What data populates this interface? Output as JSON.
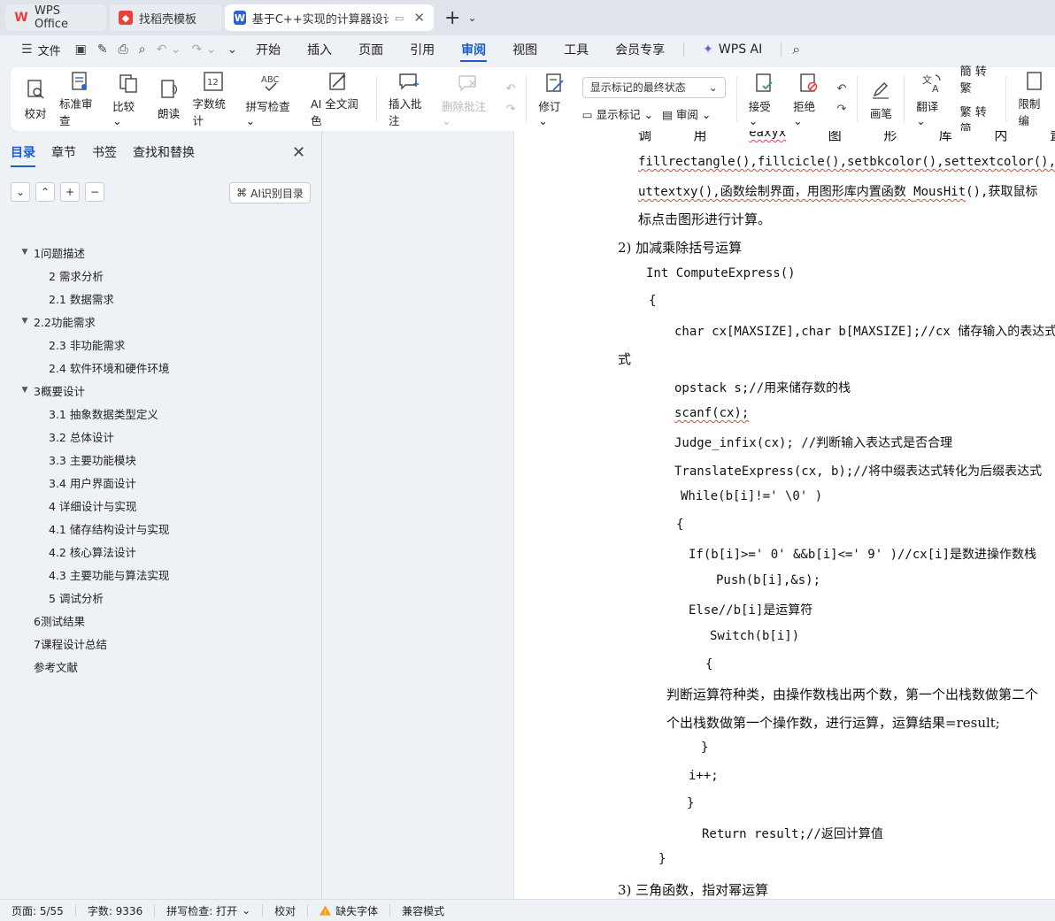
{
  "tabs": [
    {
      "label": "WPS Office",
      "active": false
    },
    {
      "label": "找稻壳模板",
      "active": false
    },
    {
      "label": "基于C++实现的计算器设计 说",
      "active": true
    }
  ],
  "menubar": {
    "file_label": "文件",
    "items": [
      "开始",
      "插入",
      "页面",
      "引用",
      "审阅",
      "视图",
      "工具",
      "会员专享"
    ],
    "active": "审阅",
    "wps_ai": "WPS AI"
  },
  "ribbon": {
    "proof": "校对",
    "std_review": "标准审查",
    "compare": "比较",
    "read": "朗读",
    "word_count": "字数统计",
    "spell_check": "拼写检查",
    "ai_polish": "AI 全文润色",
    "insert_comment": "插入批注",
    "delete_comment": "删除批注",
    "track": "修订",
    "markup_select": "显示标记的最终状态",
    "show_markup": "显示标记",
    "review_pane": "审阅",
    "accept": "接受",
    "reject": "拒绝",
    "pen": "画笔",
    "translate": "翻译",
    "to_trad": "转繁",
    "to_simp": "转简",
    "restrict": "限制编"
  },
  "nav": {
    "tabs": [
      "目录",
      "章节",
      "书签",
      "查找和替换"
    ],
    "active": "目录",
    "ai_toc": "AI识别目录",
    "toc": [
      {
        "label": "1问题描述",
        "level": 1,
        "expand": true
      },
      {
        "label": "2 需求分析",
        "level": 2
      },
      {
        "label": "2.1 数据需求",
        "level": 2
      },
      {
        "label": "2.2功能需求",
        "level": 1,
        "expand": true
      },
      {
        "label": "2.3 非功能需求",
        "level": 2
      },
      {
        "label": "2.4 软件环境和硬件环境",
        "level": 2
      },
      {
        "label": "3概要设计",
        "level": 1,
        "expand": true
      },
      {
        "label": "3.1 抽象数据类型定义",
        "level": 2
      },
      {
        "label": "3.2 总体设计",
        "level": 2
      },
      {
        "label": "3.3  主要功能模块",
        "level": 2
      },
      {
        "label": "3.4  用户界面设计",
        "level": 2
      },
      {
        "label": "4 详细设计与实现",
        "level": 2
      },
      {
        "label": "4.1  储存结构设计与实现",
        "level": 2
      },
      {
        "label": "4.2 核心算法设计",
        "level": 2
      },
      {
        "label": "4.3  主要功能与算法实现",
        "level": 2
      },
      {
        "label": "5 调试分析",
        "level": 2
      },
      {
        "label": "6测试结果",
        "level": 1
      },
      {
        "label": "7课程设计总结",
        "level": 1
      },
      {
        "label": "参考文献",
        "level": 1
      }
    ]
  },
  "doc": {
    "l1": [
      "调",
      "用",
      "eaxyx",
      "图",
      "形",
      "库",
      "内",
      "置"
    ],
    "l2": "fillrectangle(),fillcicle(),setbkcolor(),settextcolor(),set",
    "l3a": "uttextxy(),函数绘制界面，用图形库内置函数 ",
    "l3b": "MousHit",
    "l3c": "(),获取鼠标",
    "l4": "标点击图形进行计算。",
    "l5": "2)   加减乘除括号运算",
    "l6": "Int ComputeExpress()",
    "l7": "{",
    "l8": "char cx[MAXSIZE],char b[MAXSIZE];//cx 储存输入的表达式 b",
    "l9": "式",
    "l10": "opstack s;//用来储存数的栈",
    "l11": "scanf(cx);",
    "l12": "Judge_infix(cx); //判断输入表达式是否合理",
    "l13": "TranslateExpress(cx, b);//将中缀表达式转化为后缀表达式",
    "l14": "While(b[i]!=' \\0' )",
    "l15": "{",
    "l16": "If(b[i]>=' 0' &&b[i]<=' 9' )//cx[i]是数进操作数栈",
    "l17": "Push(b[i],&s);",
    "l18": "Else//b[i]是运算符",
    "l19": "Switch(b[i])",
    "l20": "{",
    "l21": "判断运算符种类，由操作数栈出两个数，第一个出栈数做第二个",
    "l22": "个出栈数做第一个操作数，进行运算，运算结果=result;",
    "l23": "}",
    "l24": "i++;",
    "l25": "}",
    "l26": "Return result;//返回计算值",
    "l27": "}",
    "l28": "3)   三角函数，指对幂运算"
  },
  "status": {
    "page": "页面: 5/55",
    "words": "字数: 9336",
    "spell": "拼写检查: 打开",
    "proof": "校对",
    "missing_font": "缺失字体",
    "compat": "兼容模式"
  },
  "colors": {
    "accent": "#1a5ccc",
    "squiggle": "#e04545",
    "wps_red": "#e8403a"
  }
}
